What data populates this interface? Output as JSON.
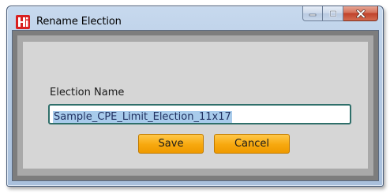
{
  "window": {
    "title": "Rename Election",
    "icon": "app-logo-icon",
    "caption_buttons": [
      "minimize-icon",
      "maximize-icon",
      "close-icon"
    ]
  },
  "form": {
    "field_label": "Election Name",
    "input_value": "Sample_CPE_Limit_Election_11x17",
    "input_selected": true
  },
  "actions": {
    "save_label": "Save",
    "cancel_label": "Cancel"
  },
  "colors": {
    "button_accent": "#f7a80e",
    "selection": "#a8cbeb",
    "input_border": "#2f6f6a",
    "icon_red": "#d82020"
  }
}
